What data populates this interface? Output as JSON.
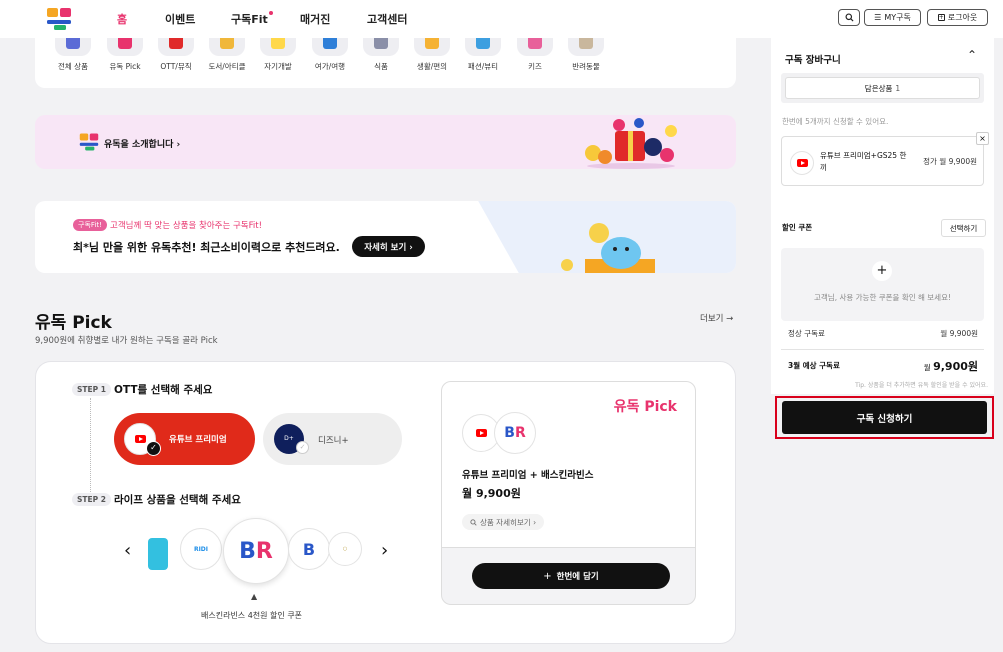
{
  "header": {
    "nav": [
      "홈",
      "이벤트",
      "구독Fit",
      "매거진",
      "고객센터"
    ],
    "my_label": "MY구독",
    "logout_label": "로그아웃"
  },
  "categories": [
    {
      "label": "전체 상품",
      "color": "#5b6bd6"
    },
    {
      "label": "유독 Pick",
      "color": "#e8336d"
    },
    {
      "label": "OTT/뮤직",
      "color": "#e02a2a"
    },
    {
      "label": "도서/아티클",
      "color": "#f0b73a"
    },
    {
      "label": "자기개발",
      "color": "#ffd84a"
    },
    {
      "label": "여가/여행",
      "color": "#2f7fd8"
    },
    {
      "label": "식품",
      "color": "#8a8fa8"
    },
    {
      "label": "생활/편의",
      "color": "#f5b234"
    },
    {
      "label": "패션/뷰티",
      "color": "#3d9fe0"
    },
    {
      "label": "키즈",
      "color": "#e8609a"
    },
    {
      "label": "반려동물",
      "color": "#c9b79d"
    }
  ],
  "banner1": {
    "text": "유독을 소개합니다 ›"
  },
  "banner2": {
    "tag": "구독Fit!",
    "line1": "고객님께 딱 맞는 상품을 찾아주는 구독Fit!",
    "line2": "최*님 만을 위한 유독추천! 최근소비이력으로 추천드려요.",
    "button": "자세히 보기 ›"
  },
  "pick": {
    "title": "유독 Pick",
    "subtitle": "9,900원에 취향별로 내가 원하는 구독을 골라 Pick",
    "more": "더보기 →",
    "step1_tag": "STEP 1",
    "step1_title": "OTT를 선택해 주세요",
    "ott1": "유튜브 프리미엄",
    "ott2": "디즈니+",
    "step2_tag": "STEP 2",
    "step2_title": "라이프 상품을 선택해 주세요",
    "carousel_caption": "배스킨라빈스 4천원 할인 쿠폰",
    "box_brand": "유독 Pick",
    "box_product": "유튜브 프리미엄 + 배스킨라빈스",
    "box_price": "월 9,900원",
    "box_detail": "상품 자세히보기 ›",
    "add_button": "한번에 담기"
  },
  "cart": {
    "title": "구독 장바구니",
    "tab_label": "담은상품",
    "tab_count": "1",
    "limit_note": "한번에 5개까지 신청할 수 있어요.",
    "item_name": "유튜브 프리미엄+GS25 한끼",
    "item_price": "정가 월 9,900원",
    "coupon_label": "할인 쿠폰",
    "coupon_select": "선택하기",
    "coupon_empty": "고객님, 사용 가능한 쿠폰을 확인 해 보세요!",
    "regular_label": "정상 구독료",
    "regular_value": "월 9,900원",
    "expected_label": "3월 예상 구독료",
    "expected_value_prefix": "월",
    "expected_value": "9,900원",
    "tip": "Tip. 상품을 더 추가하면 유독 할인을 받을 수 있어요.",
    "subscribe_button": "구독 신청하기"
  },
  "colors": {
    "accent": "#e8336d",
    "red": "#e02a1a",
    "dark": "#111111"
  }
}
